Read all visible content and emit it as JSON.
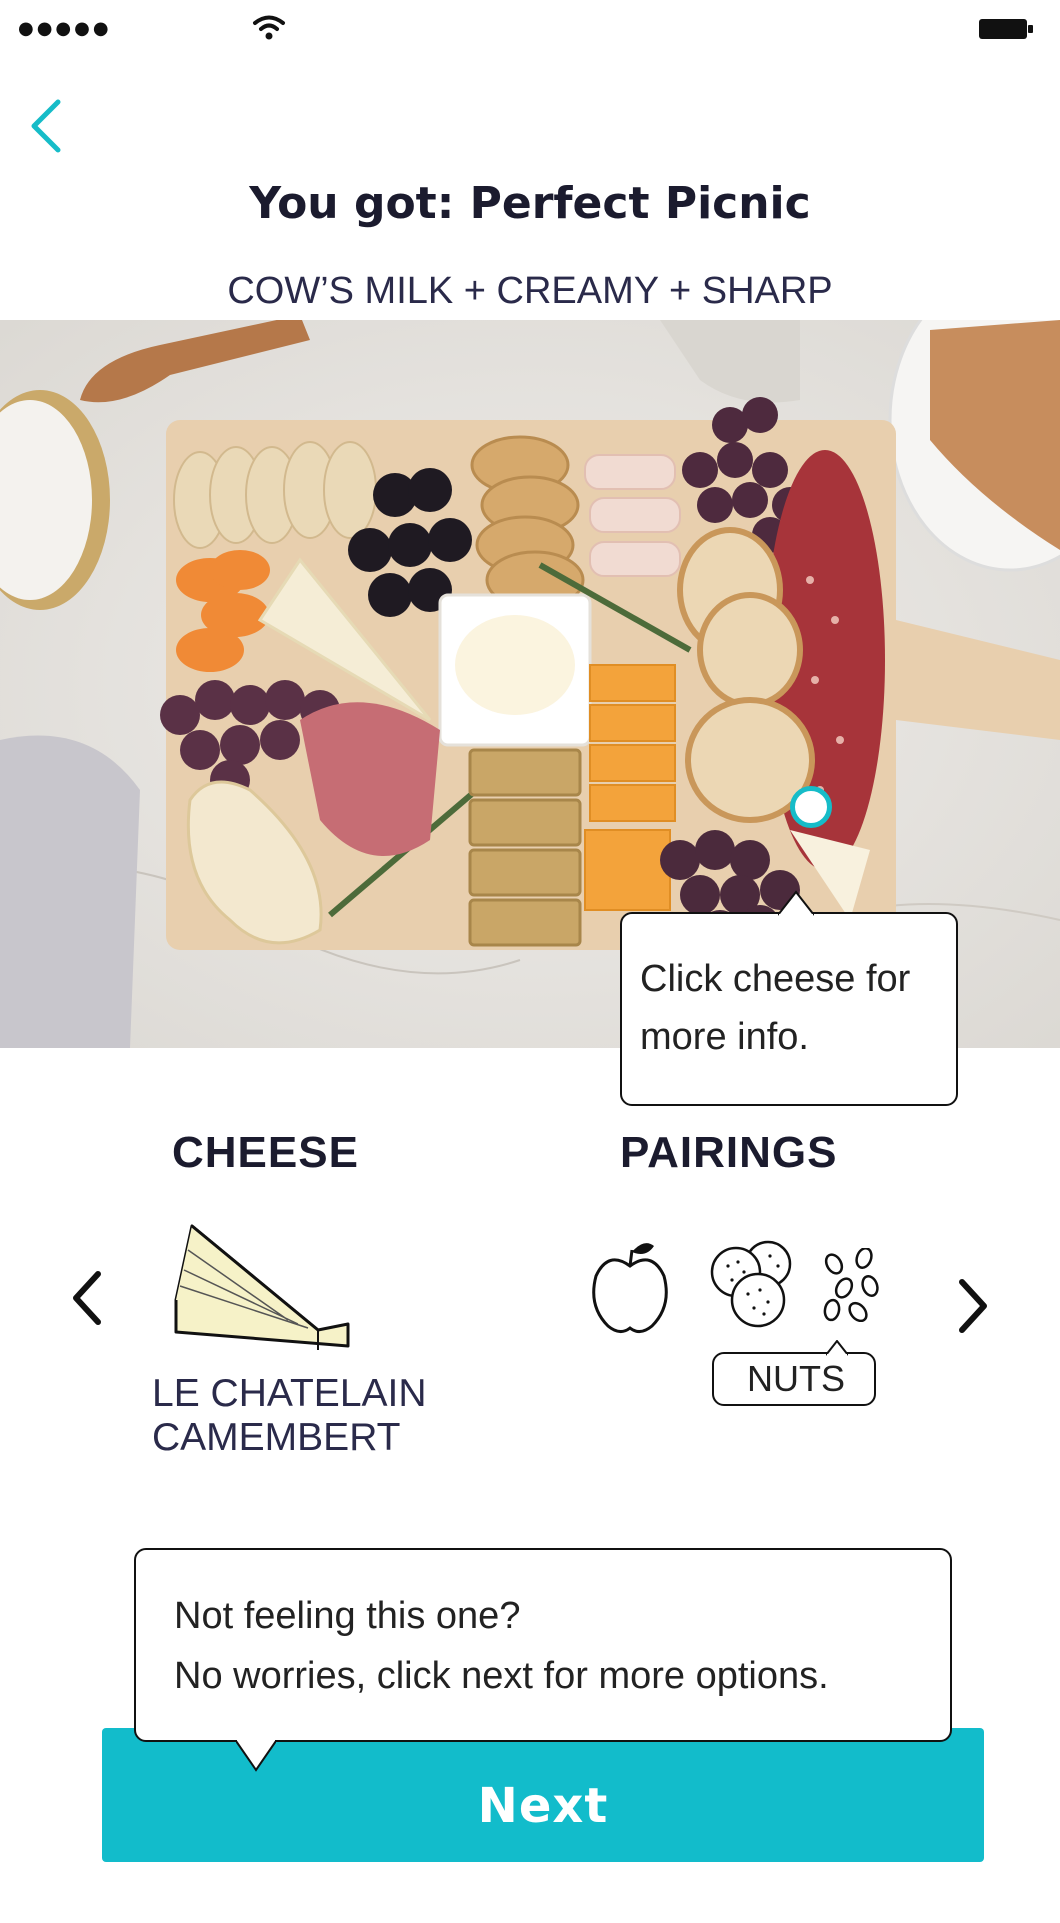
{
  "status_bar": {
    "signal": "●●●●●"
  },
  "header": {
    "title": "You got: Perfect Picnic",
    "subtitle": "COW’S MILK + CREAMY + SHARP"
  },
  "photo_tooltip": {
    "line1": "Click cheese for",
    "line2": "more info."
  },
  "sections": {
    "cheese": "CHEESE",
    "pairings": "PAIRINGS"
  },
  "cheese": {
    "name_line1": "LE CHATELAIN",
    "name_line2": "CAMEMBERT"
  },
  "pairings": {
    "items": [
      "apple-icon",
      "crackers-icon",
      "nuts-icon"
    ],
    "selected_label": "NUTS"
  },
  "prompt": {
    "line1": "Not feeling this one?",
    "line2": "No worries, click next for more options."
  },
  "next_button": {
    "label": "Next"
  },
  "colors": {
    "accent": "#12bccb",
    "text": "#1b1b2e"
  }
}
